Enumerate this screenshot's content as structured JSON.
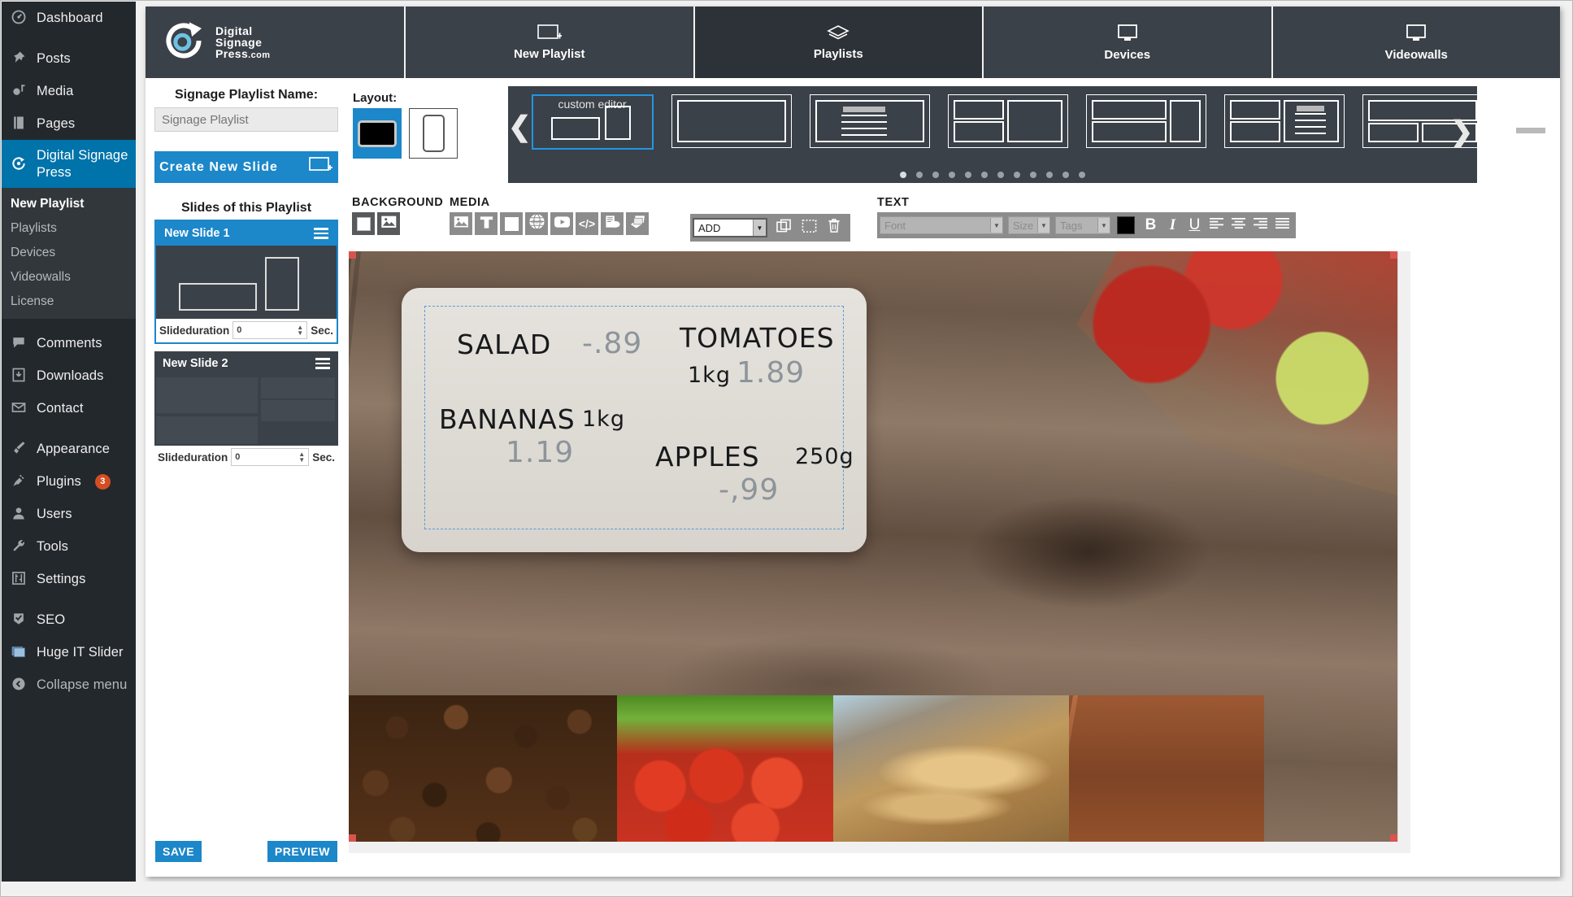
{
  "wp_sidebar": {
    "items": [
      {
        "label": "Dashboard",
        "icon": "dashboard-icon",
        "current": false
      },
      {
        "label": "Posts",
        "icon": "pin-icon",
        "current": false
      },
      {
        "label": "Media",
        "icon": "media-icon",
        "current": false
      },
      {
        "label": "Pages",
        "icon": "pages-icon",
        "current": false
      },
      {
        "label": "Digital Signage Press",
        "icon": "signage-icon",
        "current": true
      },
      {
        "label": "Comments",
        "icon": "comment-icon",
        "current": false
      },
      {
        "label": "Downloads",
        "icon": "download-icon",
        "current": false
      },
      {
        "label": "Contact",
        "icon": "mail-icon",
        "current": false
      },
      {
        "label": "Appearance",
        "icon": "brush-icon",
        "current": false
      },
      {
        "label": "Plugins",
        "icon": "plug-icon",
        "current": false,
        "badge": "3"
      },
      {
        "label": "Users",
        "icon": "user-icon",
        "current": false
      },
      {
        "label": "Tools",
        "icon": "wrench-icon",
        "current": false
      },
      {
        "label": "Settings",
        "icon": "settings-icon",
        "current": false
      },
      {
        "label": "SEO",
        "icon": "seo-icon",
        "current": false
      },
      {
        "label": "Huge IT Slider",
        "icon": "slider-icon",
        "current": false
      },
      {
        "label": "Collapse menu",
        "icon": "collapse-icon",
        "current": false
      }
    ],
    "submenu": [
      {
        "label": "New Playlist",
        "active": true
      },
      {
        "label": "Playlists",
        "active": false
      },
      {
        "label": "Devices",
        "active": false
      },
      {
        "label": "Videowalls",
        "active": false
      },
      {
        "label": "License",
        "active": false
      }
    ]
  },
  "brand": {
    "line1": "Digital",
    "line2": "Signage",
    "line3": "Press",
    "tld": ".com",
    "logo_icon": "circular-arrow-logo-icon"
  },
  "nav_tabs": [
    {
      "label": "New Playlist",
      "icon": "new-playlist-icon",
      "active": false
    },
    {
      "label": "Playlists",
      "icon": "layers-icon",
      "active": true
    },
    {
      "label": "Devices",
      "icon": "monitor-icon",
      "active": false
    },
    {
      "label": "Videowalls",
      "icon": "monitor-icon",
      "active": false
    }
  ],
  "left_panel": {
    "name_label": "Signage Playlist Name:",
    "name_value": "",
    "name_placeholder": "Signage Playlist",
    "create_slide_label": "Create New Slide",
    "create_slide_icon": "new-slide-icon",
    "slides_title": "Slides of this Playlist",
    "slides": [
      {
        "title": "New Slide 1",
        "selected": true,
        "duration_label": "Slideduration",
        "duration_value": "0",
        "duration_unit": "Sec."
      },
      {
        "title": "New Slide 2",
        "selected": false,
        "duration_label": "Slideduration",
        "duration_value": "0",
        "duration_unit": "Sec."
      }
    ],
    "save_label": "SAVE",
    "preview_label": "PREVIEW"
  },
  "layout": {
    "label": "Layout:",
    "options": [
      {
        "name": "landscape",
        "selected": true
      },
      {
        "name": "portrait",
        "selected": false
      }
    ]
  },
  "carousel": {
    "prev_icon": "chevron-left-icon",
    "next_icon": "chevron-right-icon",
    "selected_template_label": "custom editor",
    "dot_count": 12,
    "active_dot": 1
  },
  "toolbar": {
    "background": {
      "caption": "BACKGROUND",
      "buttons": [
        {
          "name": "background-color-button",
          "icon": "white-square-icon"
        },
        {
          "name": "background-image-button",
          "icon": "image-icon"
        }
      ]
    },
    "media": {
      "caption": "MEDIA",
      "buttons": [
        {
          "name": "add-image-button",
          "icon": "image-icon"
        },
        {
          "name": "add-text-button",
          "icon": "text-t-icon"
        },
        {
          "name": "add-shape-button",
          "icon": "square-icon"
        },
        {
          "name": "add-web-button",
          "icon": "www-globe-icon"
        },
        {
          "name": "add-video-button",
          "icon": "video-play-icon"
        },
        {
          "name": "add-html-button",
          "icon": "code-icon"
        },
        {
          "name": "add-weather-button",
          "icon": "weather-widget-icon"
        },
        {
          "name": "add-gallery-button",
          "icon": "layers-stack-icon"
        }
      ],
      "add_select_value": "ADD",
      "tool_buttons": [
        {
          "name": "duplicate-button",
          "icon": "copy-icon"
        },
        {
          "name": "select-button",
          "icon": "marquee-select-icon"
        },
        {
          "name": "delete-button",
          "icon": "trash-icon"
        }
      ]
    },
    "text": {
      "caption": "TEXT",
      "font_placeholder": "Font",
      "size_placeholder": "Size",
      "tags_placeholder": "Tags",
      "color": "#000000",
      "buttons": [
        {
          "name": "bold-button",
          "label": "B"
        },
        {
          "name": "italic-button",
          "label": "I"
        },
        {
          "name": "underline-button",
          "label": "U"
        },
        {
          "name": "align-left-button",
          "icon": "align-left-icon"
        },
        {
          "name": "align-center-button",
          "icon": "align-center-icon"
        },
        {
          "name": "align-right-button",
          "icon": "align-right-icon"
        },
        {
          "name": "align-justify-button",
          "icon": "align-justify-icon"
        }
      ]
    }
  },
  "canvas": {
    "board_items": [
      {
        "name": "SALAD",
        "value": "-.89"
      },
      {
        "name": "TOMATOES",
        "unit": "1kg",
        "value": "1.89"
      },
      {
        "name": "BANANAS",
        "unit": "1kg",
        "value": "1.19"
      },
      {
        "name": "APPLES",
        "unit": "250g",
        "value": "-,99"
      }
    ],
    "strip_images": [
      {
        "name": "coffee-beans-image"
      },
      {
        "name": "tomatoes-image"
      },
      {
        "name": "bread-image"
      },
      {
        "name": "wood-image"
      }
    ]
  },
  "colors": {
    "accent": "#1c87c9",
    "sidebar_bg": "#23282d",
    "topbar_bg": "#3b4148",
    "badge": "#d54e21"
  }
}
